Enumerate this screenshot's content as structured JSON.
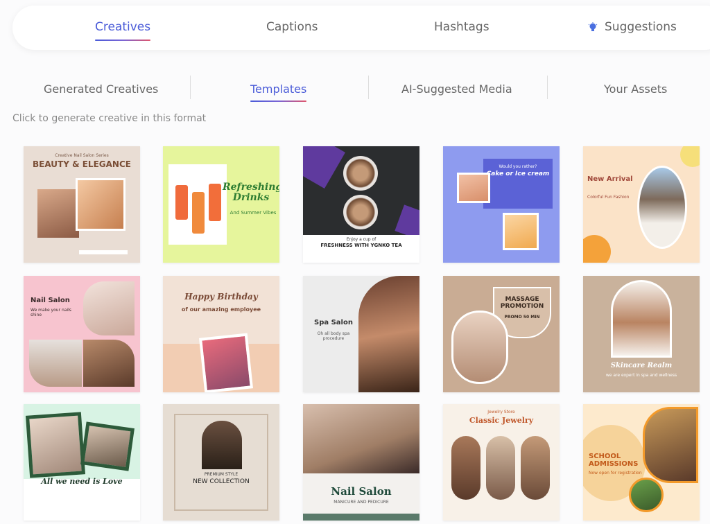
{
  "top_tabs": [
    {
      "label": "Creatives",
      "active": true
    },
    {
      "label": "Captions",
      "active": false
    },
    {
      "label": "Hashtags",
      "active": false
    },
    {
      "label": "Suggestions",
      "active": false,
      "icon": "lightbulb-icon"
    }
  ],
  "sub_tabs": [
    {
      "label": "Generated Creatives",
      "active": false
    },
    {
      "label": "Templates",
      "active": true
    },
    {
      "label": "AI-Suggested Media",
      "active": false
    },
    {
      "label": "Your Assets",
      "active": false
    }
  ],
  "hint": "Click to generate creative in this format",
  "accent_color": "#4a5bd8",
  "templates": [
    {
      "title": "BEAUTY & ELEGANCE",
      "subtitle": "Creative Nail Salon Series"
    },
    {
      "title": "Refreshing Drinks",
      "subtitle": "And Summer Vibes"
    },
    {
      "title": "FRESHNESS WITH YGNKO TEA",
      "subtitle": "Enjoy a cup of"
    },
    {
      "title": "Cake or Ice cream",
      "subtitle": "Would you rather?"
    },
    {
      "title": "New Arrival",
      "subtitle": "Colorful Fun Fashion"
    },
    {
      "title": "Nail Salon",
      "subtitle": "We make your nails shine"
    },
    {
      "title": "Happy Birthday",
      "subtitle": "of our amazing employee"
    },
    {
      "title": "Spa Salon",
      "subtitle": "Oh all body spa procedure"
    },
    {
      "title": "MASSAGE PROMOTION",
      "subtitle": "PROMO 50 MIN"
    },
    {
      "title": "Skincare Realm",
      "subtitle": "we are expert in spa and wellness"
    },
    {
      "title": "All we need is Love",
      "subtitle": ""
    },
    {
      "title": "NEW COLLECTION",
      "subtitle": "PREMIUM STYLE"
    },
    {
      "title": "Nail Salon",
      "subtitle": "MANICURE AND PEDICURE"
    },
    {
      "title": "Classic Jewelry",
      "subtitle": "Jewelry Store"
    },
    {
      "title": "SCHOOL ADMISSIONS",
      "subtitle": "Now open for registration"
    }
  ]
}
